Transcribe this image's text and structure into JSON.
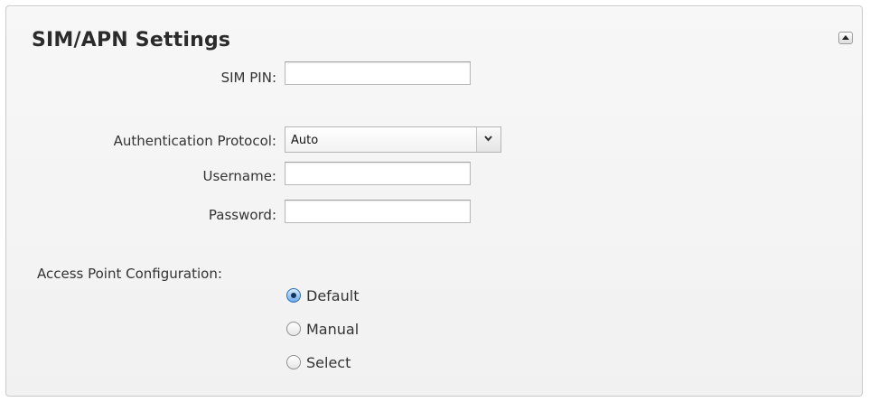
{
  "panel": {
    "title": "SIM/APN Settings",
    "collapse_icon": "collapse-up-icon"
  },
  "fields": {
    "sim_pin": {
      "label": "SIM PIN:",
      "value": ""
    },
    "auth_protocol": {
      "label": "Authentication Protocol:",
      "selected": "Auto",
      "icon": "chevron-down-icon"
    },
    "username": {
      "label": "Username:",
      "value": ""
    },
    "password": {
      "label": "Password:",
      "value": ""
    }
  },
  "access_point": {
    "label": "Access Point Configuration:",
    "options": [
      {
        "label": "Default",
        "checked": true
      },
      {
        "label": "Manual",
        "checked": false
      },
      {
        "label": "Select",
        "checked": false
      }
    ]
  }
}
